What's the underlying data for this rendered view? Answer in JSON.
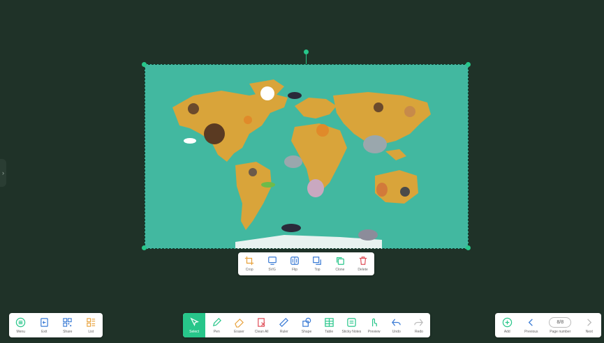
{
  "context_toolbar": {
    "items": [
      {
        "label": "Crop",
        "icon": "crop-icon"
      },
      {
        "label": "SVG",
        "icon": "svg-icon"
      },
      {
        "label": "Flip",
        "icon": "flip-icon"
      },
      {
        "label": "Top",
        "icon": "top-icon"
      },
      {
        "label": "Clone",
        "icon": "clone-icon"
      },
      {
        "label": "Delete",
        "icon": "delete-icon"
      }
    ]
  },
  "left_toolbar": {
    "items": [
      {
        "label": "Menu",
        "icon": "menu-icon"
      },
      {
        "label": "Exit",
        "icon": "exit-icon"
      },
      {
        "label": "Share",
        "icon": "share-icon"
      },
      {
        "label": "List",
        "icon": "list-icon"
      }
    ]
  },
  "main_toolbar": {
    "items": [
      {
        "label": "Select",
        "icon": "select-icon",
        "active": true
      },
      {
        "label": "Pen",
        "icon": "pen-icon"
      },
      {
        "label": "Eraser",
        "icon": "eraser-icon"
      },
      {
        "label": "Clean All",
        "icon": "clean-all-icon"
      },
      {
        "label": "Ruler",
        "icon": "ruler-icon"
      },
      {
        "label": "Shape",
        "icon": "shape-icon"
      },
      {
        "label": "Table",
        "icon": "table-icon"
      },
      {
        "label": "Sticky Notes",
        "icon": "sticky-notes-icon"
      },
      {
        "label": "Preview",
        "icon": "preview-icon"
      },
      {
        "label": "Undo",
        "icon": "undo-icon"
      },
      {
        "label": "Redo",
        "icon": "redo-icon"
      }
    ]
  },
  "right_toolbar": {
    "add_label": "Add",
    "previous_label": "Previous",
    "page_number_label": "Page number",
    "page_number_value": "8/8",
    "next_label": "Next"
  },
  "colors": {
    "accent": "#27c68a",
    "background": "#1f3228",
    "map_ocean": "#42b8a0",
    "land": "#d9a43a"
  }
}
